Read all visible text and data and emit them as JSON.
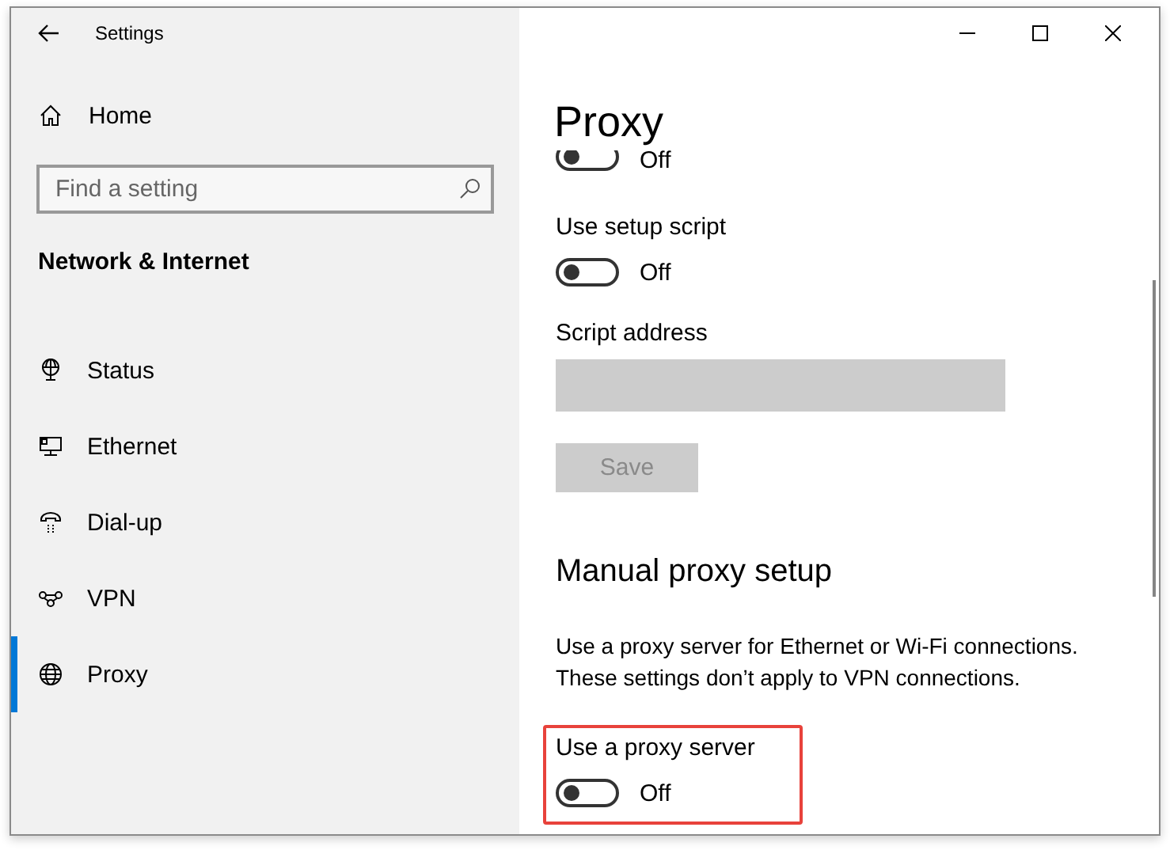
{
  "window": {
    "title": "Settings"
  },
  "sidebar": {
    "home": {
      "label": "Home"
    },
    "search": {
      "placeholder": "Find a setting"
    },
    "section": "Network & Internet",
    "items": [
      {
        "label": "Status",
        "kind": "status",
        "selected": false
      },
      {
        "label": "Ethernet",
        "kind": "ethernet",
        "selected": false
      },
      {
        "label": "Dial-up",
        "kind": "dialup",
        "selected": false
      },
      {
        "label": "VPN",
        "kind": "vpn",
        "selected": false
      },
      {
        "label": "Proxy",
        "kind": "proxy",
        "selected": true
      }
    ]
  },
  "page": {
    "title": "Proxy",
    "settings": [
      {
        "kind": "toggle",
        "clipped": true,
        "on": false,
        "state_label": "Off"
      },
      {
        "kind": "toggle",
        "label": "Use setup script",
        "on": false,
        "state_label": "Off"
      },
      {
        "kind": "field",
        "label": "Script address",
        "disabled": true
      },
      {
        "kind": "button",
        "label": "Save",
        "disabled": true
      },
      {
        "kind": "heading",
        "label": "Manual proxy setup"
      },
      {
        "kind": "text",
        "label": "Use a proxy server for Ethernet or Wi-Fi connections. These settings don’t apply to VPN connections."
      },
      {
        "kind": "toggle",
        "label": "Use a proxy server",
        "on": false,
        "state_label": "Off",
        "highlighted": true
      }
    ]
  }
}
